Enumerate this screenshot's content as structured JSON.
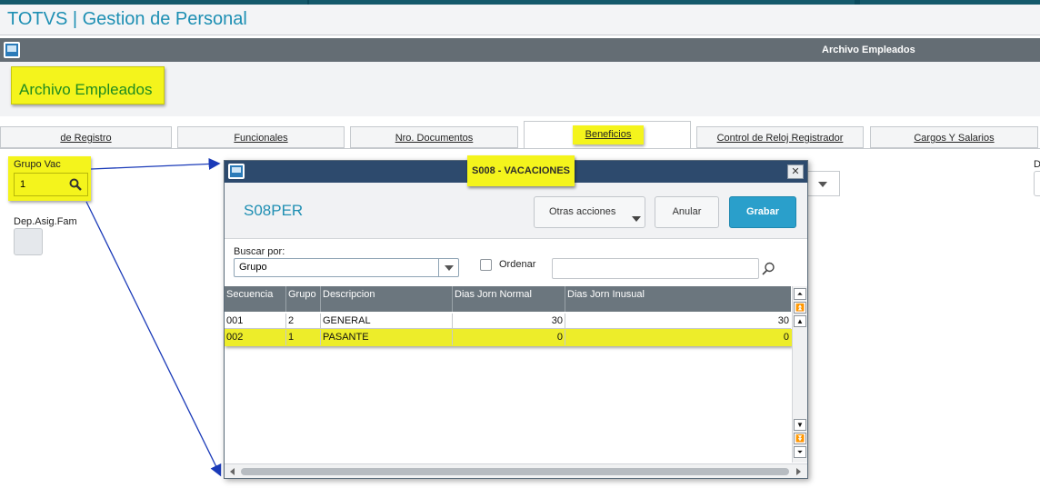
{
  "app": {
    "title": "TOTVS | Gestion de Personal"
  },
  "window": {
    "title": "Archivo Empleados",
    "icon": "window-icon"
  },
  "header": {
    "highlight_title": "Archivo Empleados"
  },
  "tabs": [
    {
      "label": "de Registro"
    },
    {
      "label": "Funcionales"
    },
    {
      "label": "Nro. Documentos"
    },
    {
      "label": "Beneficios",
      "active": true
    },
    {
      "label": "Control de Reloj Registrador"
    },
    {
      "label": "Cargos Y Salarios"
    }
  ],
  "form": {
    "grupo_vac": {
      "label": "Grupo Vac",
      "value": "1"
    },
    "dep_asig_fam": {
      "label": "Dep.Asig.Fam"
    },
    "right_label": "D"
  },
  "dialog": {
    "title": "S008 - VACACIONES",
    "table_code": "S08PER",
    "buttons": {
      "otras": "Otras acciones",
      "anular": "Anular",
      "grabar": "Grabar"
    },
    "search": {
      "label": "Buscar por:",
      "selected": "Grupo",
      "order_label": "Ordenar",
      "text": ""
    },
    "grid": {
      "columns": [
        "Secuencia",
        "Grupo",
        "Descripcion",
        "Dias Jorn Normal",
        "Dias Jorn Inusual"
      ],
      "rows": [
        [
          "001",
          "2",
          "GENERAL",
          "30",
          "30"
        ],
        [
          "002",
          "1",
          "PASANTE",
          "0",
          "0"
        ]
      ]
    }
  },
  "colors": {
    "accent": "#1d8fb3",
    "highlight": "#f4f41c",
    "primary_button": "#2a9fcb",
    "grid_header": "#6b767e",
    "dialog_titlebar": "#2d4a6d",
    "arrow": "#1a3ab8"
  }
}
